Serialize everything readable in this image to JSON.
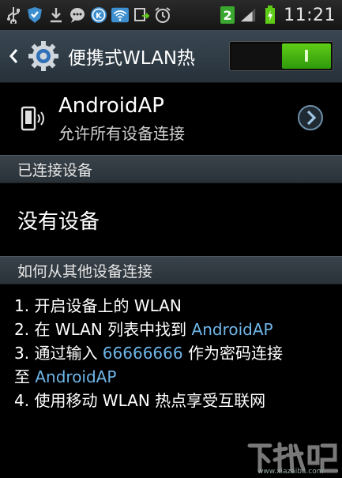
{
  "status_bar": {
    "time": "11:21",
    "notification_count": "2",
    "icons": [
      "usb-icon",
      "shield-icon",
      "download-icon",
      "chat-icon",
      "k-app-icon",
      "wifi-hotspot-icon",
      "sync-icon",
      "alarm-icon",
      "signal-icon",
      "battery-charging-icon"
    ]
  },
  "action_bar": {
    "title": "便携式WLAN热",
    "switch_label": "I",
    "switch_state": "on"
  },
  "network": {
    "name": "AndroidAP",
    "subtitle": "允许所有设备连接"
  },
  "connected_section": {
    "header": "已连接设备",
    "empty_text": "没有设备"
  },
  "howto_section": {
    "header": "如何从其他设备连接",
    "steps": [
      {
        "pre": "1. 开启设备上的 WLAN",
        "hl": "",
        "post": ""
      },
      {
        "pre": "2. 在 WLAN 列表中找到 ",
        "hl": "AndroidAP",
        "post": ""
      },
      {
        "pre": "3. 通过输入 ",
        "hl": "66666666",
        "post": " 作为密码连接"
      },
      {
        "pre": "至 ",
        "hl": "AndroidAP",
        "post": ""
      },
      {
        "pre": "4. 使用移动 WLAN 热点享受互联网",
        "hl": "",
        "post": ""
      }
    ]
  },
  "watermark": {
    "logo_text": "下载吧",
    "url": "www.xiazaiba.com"
  },
  "colors": {
    "accent_link": "#6fb6e8",
    "switch_on": "#4fb812",
    "header_bg": "#2f3a43"
  }
}
